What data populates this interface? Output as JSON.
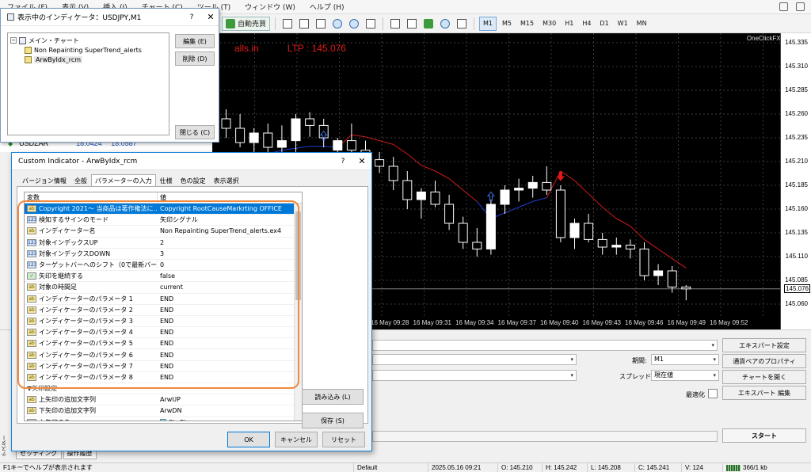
{
  "menu": [
    "ファイル (F)",
    "表示 (V)",
    "挿入 (I)",
    "チャート (C)",
    "ツール (T)",
    "ウィンドウ (W)",
    "ヘルプ (H)"
  ],
  "toolbar": {
    "auto_trade_label": "自動売買",
    "timeframes": [
      "M1",
      "M5",
      "M15",
      "M30",
      "H1",
      "H4",
      "D1",
      "W1",
      "MN"
    ],
    "selected_timeframe": "M1"
  },
  "indicator_list": {
    "title": "表示中のインディケータ：USDJPY,M1",
    "help": "?",
    "close": "✕",
    "tree_root": "メイン・チャート",
    "items": [
      "Non Repainting SuperTrend_alerts",
      "ArwByIdx_rcm"
    ],
    "edit_button": "編集 (E)",
    "delete_button": "削除 (D)",
    "close_button": "閉じる (C)"
  },
  "market_watch": {
    "symbol": "USDZAR",
    "bid": "18.0424",
    "ask": "18.0587"
  },
  "chart": {
    "header_text": "alls.in",
    "ltp_text": "LTP : 145.076",
    "corner_label": "OneClickFX",
    "current_price": "145.076",
    "price_labels": [
      "145.335",
      "145.310",
      "145.285",
      "145.260",
      "145.235",
      "145.210",
      "145.185",
      "145.160",
      "145.135",
      "145.110",
      "145.085",
      "145.060"
    ],
    "time_labels": [
      "16 May 09:28",
      "16 May 09:31",
      "16 May 09:34",
      "16 May 09:37",
      "16 May 09:40",
      "16 May 09:43",
      "16 May 09:46",
      "16 May 09:49",
      "16 May 09:52"
    ],
    "colors": {
      "background": "#000000",
      "bull_candle": "#ffffff",
      "bear_candle": "#000000",
      "supertrend_up": "#1f3fd0",
      "supertrend_down": "#d01a1a",
      "arrow_up": "#3d6be0",
      "arrow_down": "#e01a1a"
    }
  },
  "chart_data": {
    "type": "candlestick",
    "title": "",
    "xlabel": "",
    "ylabel": "",
    "ylim": [
      145.045,
      145.345
    ],
    "candles": [
      {
        "o": 145.255,
        "h": 145.265,
        "l": 145.235,
        "c": 145.245
      },
      {
        "o": 145.245,
        "h": 145.26,
        "l": 145.225,
        "c": 145.23
      },
      {
        "o": 145.23,
        "h": 145.245,
        "l": 145.21,
        "c": 145.24
      },
      {
        "o": 145.24,
        "h": 145.25,
        "l": 145.215,
        "c": 145.225
      },
      {
        "o": 145.225,
        "h": 145.248,
        "l": 145.21,
        "c": 145.232
      },
      {
        "o": 145.232,
        "h": 145.26,
        "l": 145.22,
        "c": 145.255
      },
      {
        "o": 145.255,
        "h": 145.262,
        "l": 145.236,
        "c": 145.248
      },
      {
        "o": 145.248,
        "h": 145.255,
        "l": 145.225,
        "c": 145.235
      },
      {
        "o": 145.222,
        "h": 145.235,
        "l": 145.2,
        "c": 145.232
      },
      {
        "o": 145.232,
        "h": 145.25,
        "l": 145.22,
        "c": 145.222
      },
      {
        "o": 145.222,
        "h": 145.232,
        "l": 145.2,
        "c": 145.212
      },
      {
        "o": 145.212,
        "h": 145.22,
        "l": 145.198,
        "c": 145.205
      },
      {
        "o": 145.205,
        "h": 145.215,
        "l": 145.18,
        "c": 145.19
      },
      {
        "o": 145.19,
        "h": 145.2,
        "l": 145.16,
        "c": 145.17
      },
      {
        "o": 145.17,
        "h": 145.182,
        "l": 145.15,
        "c": 145.178
      },
      {
        "o": 145.178,
        "h": 145.19,
        "l": 145.162,
        "c": 145.165
      },
      {
        "o": 145.165,
        "h": 145.175,
        "l": 145.138,
        "c": 145.145
      },
      {
        "o": 145.145,
        "h": 145.152,
        "l": 145.118,
        "c": 145.125
      },
      {
        "o": 145.125,
        "h": 145.14,
        "l": 145.11,
        "c": 145.118
      },
      {
        "o": 145.118,
        "h": 145.17,
        "l": 145.112,
        "c": 145.165
      },
      {
        "o": 145.165,
        "h": 145.185,
        "l": 145.155,
        "c": 145.18
      },
      {
        "o": 145.18,
        "h": 145.192,
        "l": 145.168,
        "c": 145.182
      },
      {
        "o": 145.182,
        "h": 145.195,
        "l": 145.172,
        "c": 145.188
      },
      {
        "o": 145.188,
        "h": 145.205,
        "l": 145.175,
        "c": 145.18
      },
      {
        "o": 145.18,
        "h": 145.185,
        "l": 145.125,
        "c": 145.13
      },
      {
        "o": 145.13,
        "h": 145.15,
        "l": 145.118,
        "c": 145.145
      },
      {
        "o": 145.145,
        "h": 145.155,
        "l": 145.125,
        "c": 145.128
      },
      {
        "o": 145.128,
        "h": 145.135,
        "l": 145.112,
        "c": 145.12
      },
      {
        "o": 145.12,
        "h": 145.13,
        "l": 145.112,
        "c": 145.122
      },
      {
        "o": 145.122,
        "h": 145.128,
        "l": 145.108,
        "c": 145.118
      },
      {
        "o": 145.118,
        "h": 145.125,
        "l": 145.085,
        "c": 145.09
      },
      {
        "o": 145.09,
        "h": 145.102,
        "l": 145.08,
        "c": 145.095
      },
      {
        "o": 145.095,
        "h": 145.1,
        "l": 145.072,
        "c": 145.078
      },
      {
        "o": 145.078,
        "h": 145.08,
        "l": 145.064,
        "c": 145.076
      }
    ],
    "supertrend": [
      145.21,
      145.212,
      145.215,
      145.218,
      145.222,
      145.224,
      145.226,
      145.226,
      145.225,
      145.238,
      145.236,
      145.232,
      145.228,
      145.218,
      145.206,
      145.2,
      145.192,
      145.18,
      145.168,
      145.15,
      145.156,
      145.162,
      145.168,
      145.172,
      145.2,
      145.19,
      145.176,
      145.162,
      145.15,
      145.142,
      145.128,
      145.118,
      145.108,
      145.098
    ],
    "up_arrows": [
      {
        "i": 7,
        "y": 145.242
      },
      {
        "i": 19,
        "y": 145.178
      }
    ],
    "down_arrows": [
      {
        "i": 10,
        "y": 145.21
      },
      {
        "i": 24,
        "y": 145.19
      }
    ],
    "grid": true
  },
  "dialog": {
    "title": "Custom Indicator - ArwByIdx_rcm",
    "help": "?",
    "close": "✕",
    "tabs": [
      "バージョン情報",
      "全般",
      "パラメーターの入力",
      "仕様",
      "色の設定",
      "表示選択"
    ],
    "active_tab": 2,
    "columns": [
      "変数",
      "値"
    ],
    "params": [
      {
        "type": "ab",
        "name": "Copyright 2021〜 当商品は著作権法に...",
        "value": "Copyright RootCauseMarkrting OFFICE",
        "selected": true
      },
      {
        "type": "123",
        "name": "検知するサインのモード",
        "value": "矢印シグナル"
      },
      {
        "type": "ab",
        "name": "インディケーター名",
        "value": "Non Repainting SuperTrend_alerts.ex4"
      },
      {
        "type": "123",
        "name": "対象インデックスUP",
        "value": "2"
      },
      {
        "type": "123",
        "name": "対象インデックスDOWN",
        "value": "3"
      },
      {
        "type": "123",
        "name": "ターゲットバーへのシフト（0で最新バー）",
        "value": "0"
      },
      {
        "type": "bool",
        "name": "矢印を継続する",
        "value": "false"
      },
      {
        "type": "ab",
        "name": "対象の時間足",
        "value": "current"
      },
      {
        "type": "ab",
        "name": "インディケーターのパラメータ 1",
        "value": "END"
      },
      {
        "type": "ab",
        "name": "インディケーターのパラメータ 2",
        "value": "END"
      },
      {
        "type": "ab",
        "name": "インディケーターのパラメータ 3",
        "value": "END"
      },
      {
        "type": "ab",
        "name": "インディケーターのパラメータ 4",
        "value": "END"
      },
      {
        "type": "ab",
        "name": "インディケーターのパラメータ 5",
        "value": "END"
      },
      {
        "type": "ab",
        "name": "インディケーターのパラメータ 6",
        "value": "END"
      },
      {
        "type": "ab",
        "name": "インディケーターのパラメータ 7",
        "value": "END"
      },
      {
        "type": "ab",
        "name": "インディケーターのパラメータ 8",
        "value": "END"
      },
      {
        "type": "section",
        "name": "▼矢印設定",
        "value": ""
      },
      {
        "type": "ab",
        "name": "上矢印の追加文字列",
        "value": "ArwUP"
      },
      {
        "type": "ab",
        "name": "下矢印の追加文字列",
        "value": "ArwDN"
      },
      {
        "type": "color",
        "name": "上矢印の色",
        "value": "SkyBlue"
      }
    ],
    "load_button": "読み込み (L)",
    "save_button": "保存 (S)",
    "ok_button": "OK",
    "cancel_button": "キャンセル",
    "reset_button": "リセット"
  },
  "tester": {
    "period_label": "期間:",
    "period_value": "M1",
    "spread_label": "スプレッド:",
    "spread_value": "現在値",
    "optimize_label": "最適化",
    "btn_expert_settings": "エキスパート設定",
    "btn_symbol_props": "通貨ペアのプロパティ",
    "btn_open_chart": "チャートを開く",
    "btn_expert_edit": "エキスパート 編集",
    "btn_start": "スタート",
    "tab_settings": "セッティング",
    "tab_journal": "操作履歴",
    "side_label": "テスター"
  },
  "status": {
    "help": "F1キーでヘルプが表示されます",
    "profile": "Default",
    "datetime": "2025.05.16 09:21",
    "open": "O: 145.210",
    "high": "H: 145.242",
    "low": "L: 145.208",
    "close": "C: 145.241",
    "volume": "V: 124",
    "net": "366/1 kb"
  }
}
